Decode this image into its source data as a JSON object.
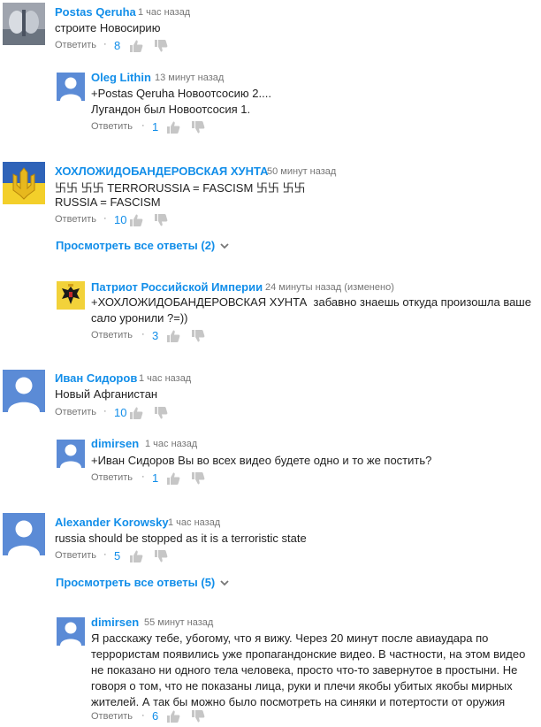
{
  "reply_label": "Ответить",
  "comments": [
    {
      "id": "c1",
      "author": "Postas Qeruha",
      "time": "1 час назад",
      "lines": [
        "строите Новосирию"
      ],
      "likes": "8"
    },
    {
      "id": "c2",
      "author": "Oleg Lithin",
      "time": "13 минут назад",
      "lines": [
        "+Postas Qeruha Новоотсосию 2....",
        "Лугандон был Новоотсосия 1."
      ],
      "likes": "1"
    },
    {
      "id": "c3",
      "author": "ХОХЛОЖИДОБАНДЕРОВСКАЯ ХУНТА",
      "time": "50 минут назад",
      "lines": [
        "卐卐 卐卐 TERRORUSSIA = FASCISM 卐卐 卐卐",
        "RUSSIA = FASCISM"
      ],
      "likes": "10"
    },
    {
      "id": "c4",
      "author": "Патриот Российской Империи",
      "time": "24 минуты назад (изменено)",
      "lines": [
        "+ХОХЛОЖИДОБАНДЕРОВСКАЯ ХУНТА  забавно знаешь откуда произошла ваше",
        "сало уронили ?=))"
      ],
      "likes": "3"
    },
    {
      "id": "c5",
      "author": "Иван Сидоров",
      "time": "1 час назад",
      "lines": [
        "Новый Афганистан"
      ],
      "likes": "10"
    },
    {
      "id": "c6",
      "author": "dimirsen",
      "time": "1 час назад",
      "lines": [
        "+Иван Сидоров Вы во всех видео будете одно и то же постить?"
      ],
      "likes": "1"
    },
    {
      "id": "c7",
      "author": "Alexander Korowsky",
      "time": "1 час назад",
      "lines": [
        "russia should be stopped as it is a terroristic state"
      ],
      "likes": "5"
    },
    {
      "id": "c8",
      "author": "dimirsen",
      "time": "55 минут назад",
      "lines": [
        "Я расскажу тебе, убогому, что я вижу. Через 20 минут после авиаудара по",
        "террористам появились уже пропагандонские видео. В частности, на этом видео",
        "не показано ни одного тела человека, просто что-то завернутое в простыни. Не",
        "говоря о том, что не показаны лица, руки и плечи якобы убитых якобы мирных",
        "жителей. А так бы можно было посмотреть на синяки и потертости от оружия"
      ],
      "likes": "6"
    }
  ],
  "view_replies": [
    {
      "label": "Просмотреть все ответы (2)"
    },
    {
      "label": "Просмотреть все ответы (5)"
    }
  ],
  "colors": {
    "link": "#128ee9",
    "meta": "#767676",
    "avatar_default": "#5b8bd6"
  },
  "icons": [
    "like-icon",
    "dislike-icon",
    "chevron-down-icon",
    "default-avatar-icon"
  ]
}
